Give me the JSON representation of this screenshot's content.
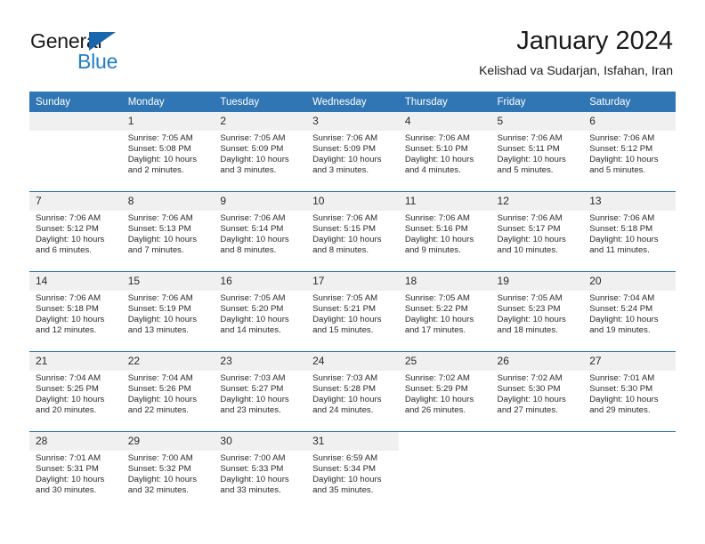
{
  "brand": {
    "name_part1": "General",
    "name_part2": "Blue",
    "flag_icon": "blue-triangle-flag-icon"
  },
  "header": {
    "title": "January 2024",
    "subtitle": "Kelishad va Sudarjan, Isfahan, Iran"
  },
  "colors": {
    "header_blue": "#3076b4",
    "brand_blue": "#1f7ec4",
    "daynum_background": "#f0f0f0",
    "text": "#2a2a2a"
  },
  "weekday_headers": [
    "Sunday",
    "Monday",
    "Tuesday",
    "Wednesday",
    "Thursday",
    "Friday",
    "Saturday"
  ],
  "weeks": [
    [
      {
        "empty": true
      },
      {
        "day": "1",
        "sunrise": "Sunrise: 7:05 AM",
        "sunset": "Sunset: 5:08 PM",
        "daylight": "Daylight: 10 hours and 2 minutes."
      },
      {
        "day": "2",
        "sunrise": "Sunrise: 7:05 AM",
        "sunset": "Sunset: 5:09 PM",
        "daylight": "Daylight: 10 hours and 3 minutes."
      },
      {
        "day": "3",
        "sunrise": "Sunrise: 7:06 AM",
        "sunset": "Sunset: 5:09 PM",
        "daylight": "Daylight: 10 hours and 3 minutes."
      },
      {
        "day": "4",
        "sunrise": "Sunrise: 7:06 AM",
        "sunset": "Sunset: 5:10 PM",
        "daylight": "Daylight: 10 hours and 4 minutes."
      },
      {
        "day": "5",
        "sunrise": "Sunrise: 7:06 AM",
        "sunset": "Sunset: 5:11 PM",
        "daylight": "Daylight: 10 hours and 5 minutes."
      },
      {
        "day": "6",
        "sunrise": "Sunrise: 7:06 AM",
        "sunset": "Sunset: 5:12 PM",
        "daylight": "Daylight: 10 hours and 5 minutes."
      }
    ],
    [
      {
        "day": "7",
        "sunrise": "Sunrise: 7:06 AM",
        "sunset": "Sunset: 5:12 PM",
        "daylight": "Daylight: 10 hours and 6 minutes."
      },
      {
        "day": "8",
        "sunrise": "Sunrise: 7:06 AM",
        "sunset": "Sunset: 5:13 PM",
        "daylight": "Daylight: 10 hours and 7 minutes."
      },
      {
        "day": "9",
        "sunrise": "Sunrise: 7:06 AM",
        "sunset": "Sunset: 5:14 PM",
        "daylight": "Daylight: 10 hours and 8 minutes."
      },
      {
        "day": "10",
        "sunrise": "Sunrise: 7:06 AM",
        "sunset": "Sunset: 5:15 PM",
        "daylight": "Daylight: 10 hours and 8 minutes."
      },
      {
        "day": "11",
        "sunrise": "Sunrise: 7:06 AM",
        "sunset": "Sunset: 5:16 PM",
        "daylight": "Daylight: 10 hours and 9 minutes."
      },
      {
        "day": "12",
        "sunrise": "Sunrise: 7:06 AM",
        "sunset": "Sunset: 5:17 PM",
        "daylight": "Daylight: 10 hours and 10 minutes."
      },
      {
        "day": "13",
        "sunrise": "Sunrise: 7:06 AM",
        "sunset": "Sunset: 5:18 PM",
        "daylight": "Daylight: 10 hours and 11 minutes."
      }
    ],
    [
      {
        "day": "14",
        "sunrise": "Sunrise: 7:06 AM",
        "sunset": "Sunset: 5:18 PM",
        "daylight": "Daylight: 10 hours and 12 minutes."
      },
      {
        "day": "15",
        "sunrise": "Sunrise: 7:06 AM",
        "sunset": "Sunset: 5:19 PM",
        "daylight": "Daylight: 10 hours and 13 minutes."
      },
      {
        "day": "16",
        "sunrise": "Sunrise: 7:05 AM",
        "sunset": "Sunset: 5:20 PM",
        "daylight": "Daylight: 10 hours and 14 minutes."
      },
      {
        "day": "17",
        "sunrise": "Sunrise: 7:05 AM",
        "sunset": "Sunset: 5:21 PM",
        "daylight": "Daylight: 10 hours and 15 minutes."
      },
      {
        "day": "18",
        "sunrise": "Sunrise: 7:05 AM",
        "sunset": "Sunset: 5:22 PM",
        "daylight": "Daylight: 10 hours and 17 minutes."
      },
      {
        "day": "19",
        "sunrise": "Sunrise: 7:05 AM",
        "sunset": "Sunset: 5:23 PM",
        "daylight": "Daylight: 10 hours and 18 minutes."
      },
      {
        "day": "20",
        "sunrise": "Sunrise: 7:04 AM",
        "sunset": "Sunset: 5:24 PM",
        "daylight": "Daylight: 10 hours and 19 minutes."
      }
    ],
    [
      {
        "day": "21",
        "sunrise": "Sunrise: 7:04 AM",
        "sunset": "Sunset: 5:25 PM",
        "daylight": "Daylight: 10 hours and 20 minutes."
      },
      {
        "day": "22",
        "sunrise": "Sunrise: 7:04 AM",
        "sunset": "Sunset: 5:26 PM",
        "daylight": "Daylight: 10 hours and 22 minutes."
      },
      {
        "day": "23",
        "sunrise": "Sunrise: 7:03 AM",
        "sunset": "Sunset: 5:27 PM",
        "daylight": "Daylight: 10 hours and 23 minutes."
      },
      {
        "day": "24",
        "sunrise": "Sunrise: 7:03 AM",
        "sunset": "Sunset: 5:28 PM",
        "daylight": "Daylight: 10 hours and 24 minutes."
      },
      {
        "day": "25",
        "sunrise": "Sunrise: 7:02 AM",
        "sunset": "Sunset: 5:29 PM",
        "daylight": "Daylight: 10 hours and 26 minutes."
      },
      {
        "day": "26",
        "sunrise": "Sunrise: 7:02 AM",
        "sunset": "Sunset: 5:30 PM",
        "daylight": "Daylight: 10 hours and 27 minutes."
      },
      {
        "day": "27",
        "sunrise": "Sunrise: 7:01 AM",
        "sunset": "Sunset: 5:30 PM",
        "daylight": "Daylight: 10 hours and 29 minutes."
      }
    ],
    [
      {
        "day": "28",
        "sunrise": "Sunrise: 7:01 AM",
        "sunset": "Sunset: 5:31 PM",
        "daylight": "Daylight: 10 hours and 30 minutes."
      },
      {
        "day": "29",
        "sunrise": "Sunrise: 7:00 AM",
        "sunset": "Sunset: 5:32 PM",
        "daylight": "Daylight: 10 hours and 32 minutes."
      },
      {
        "day": "30",
        "sunrise": "Sunrise: 7:00 AM",
        "sunset": "Sunset: 5:33 PM",
        "daylight": "Daylight: 10 hours and 33 minutes."
      },
      {
        "day": "31",
        "sunrise": "Sunrise: 6:59 AM",
        "sunset": "Sunset: 5:34 PM",
        "daylight": "Daylight: 10 hours and 35 minutes."
      },
      {
        "blank": true
      },
      {
        "blank": true
      },
      {
        "blank": true
      }
    ]
  ]
}
